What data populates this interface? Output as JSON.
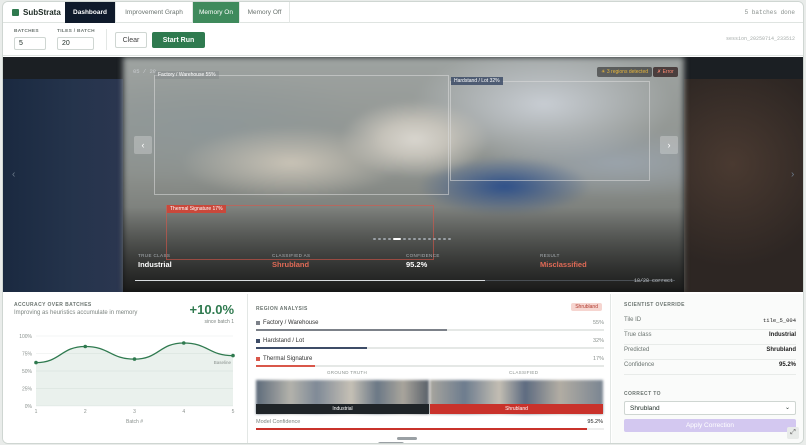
{
  "brand": {
    "name": "SubStrata",
    "icon": "layers-icon"
  },
  "tabs": [
    {
      "label": "Dashboard"
    },
    {
      "label": "Improvement Graph"
    },
    {
      "label": "Memory On"
    },
    {
      "label": "Memory Off"
    }
  ],
  "nav_status": "5 batches done",
  "controls": {
    "batches_label": "BATCHES",
    "batches_value": "5",
    "tiles_label": "TILES / BATCH",
    "tiles_value": "20",
    "clear_label": "Clear",
    "start_label": "Start Run",
    "session": "session_20250714_233512"
  },
  "viewer": {
    "counter": "05 / 20",
    "regions_chip": "☀ 3 regions detected",
    "error_chip": "✗ Error",
    "boxes": [
      {
        "label": "Factory / Warehouse 55%"
      },
      {
        "label": "Hardstand / Lot 32%"
      },
      {
        "label": "Thermal Signature 17%"
      }
    ],
    "stats": {
      "true_class_label": "TRUE CLASS",
      "true_class": "Industrial",
      "classified_label": "CLASSIFIED AS",
      "classified": "Shrubland",
      "confidence_label": "CONFIDENCE",
      "confidence": "95.2%",
      "result_label": "RESULT",
      "result": "Misclassified"
    },
    "correct": "18/28 correct"
  },
  "accuracy": {
    "title": "ACCURACY OVER BATCHES",
    "subtitle": "Improving as heuristics accumulate in memory",
    "delta": "+10.0%",
    "since": "since batch 1",
    "baseline_label": "Baseline",
    "xlabel": "Batch #"
  },
  "chart_data": {
    "type": "area",
    "x": [
      1,
      2,
      3,
      4,
      5
    ],
    "values": [
      62,
      85,
      67,
      90,
      72
    ],
    "xticks": [
      "1",
      "2",
      "3",
      "4",
      "5"
    ],
    "yticks": [
      "100%",
      "75%",
      "50%",
      "25%",
      "0%"
    ],
    "ylim": [
      0,
      100
    ],
    "xlabel": "Batch #",
    "color": "#2f7a4f"
  },
  "regions": {
    "title": "REGION ANALYSIS",
    "tag": "Shrubland",
    "items": [
      {
        "name": "Factory / Warehouse",
        "pct": "55%",
        "frac": 0.55,
        "color": "#7c8189"
      },
      {
        "name": "Hardstand / Lot",
        "pct": "32%",
        "frac": 0.32,
        "color": "#3d4c67"
      },
      {
        "name": "Thermal Signature",
        "pct": "17%",
        "frac": 0.17,
        "color": "#d9574a"
      }
    ],
    "gt_label": "GROUND TRUTH",
    "cls_label": "CLASSIFIED",
    "gt_caption": "Industrial",
    "cls_caption": "Shrubland",
    "model_conf_label": "Model Confidence",
    "model_conf": "95.2%",
    "model_conf_frac": 0.952
  },
  "override": {
    "title": "SCIENTIST OVERRIDE",
    "rows": [
      {
        "k": "Tile ID",
        "v": "tile_5_004"
      },
      {
        "k": "True class",
        "v": "Industrial"
      },
      {
        "k": "Predicted",
        "v": "Shrubland"
      },
      {
        "k": "Confidence",
        "v": "95.2%"
      }
    ],
    "correct_to_label": "CORRECT TO",
    "select_value": "Shrubland",
    "apply_label": "Apply Correction"
  },
  "colors": {
    "accent": "#2f7a4f",
    "error": "#d9574a",
    "nav_dark": "#0f1a2b"
  }
}
